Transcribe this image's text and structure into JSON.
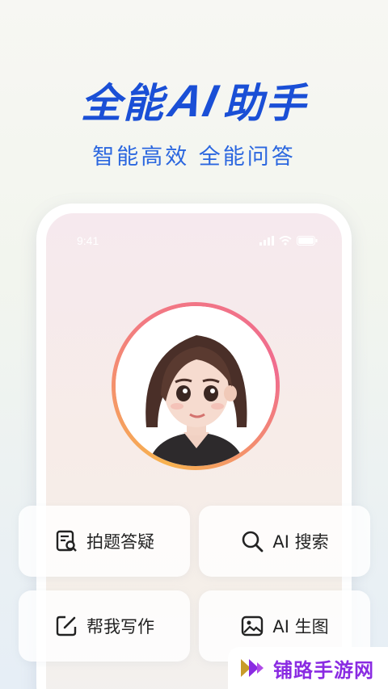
{
  "headline": {
    "before": "全能",
    "ai": "AI",
    "after": "助手"
  },
  "subtitle": "智能高效 全能问答",
  "phone": {
    "time": "9:41"
  },
  "actions": [
    {
      "label": "拍题答疑",
      "icon": "photo-question-icon"
    },
    {
      "label": "AI 搜索",
      "icon": "search-icon"
    },
    {
      "label": "帮我写作",
      "icon": "edit-icon"
    },
    {
      "label": "AI 生图",
      "icon": "image-icon"
    }
  ],
  "watermark": {
    "text": "铺路手游网"
  },
  "colors": {
    "brand": "#1a4fd6",
    "subtitle": "#2b67df",
    "watermark": "#8a2be2"
  }
}
